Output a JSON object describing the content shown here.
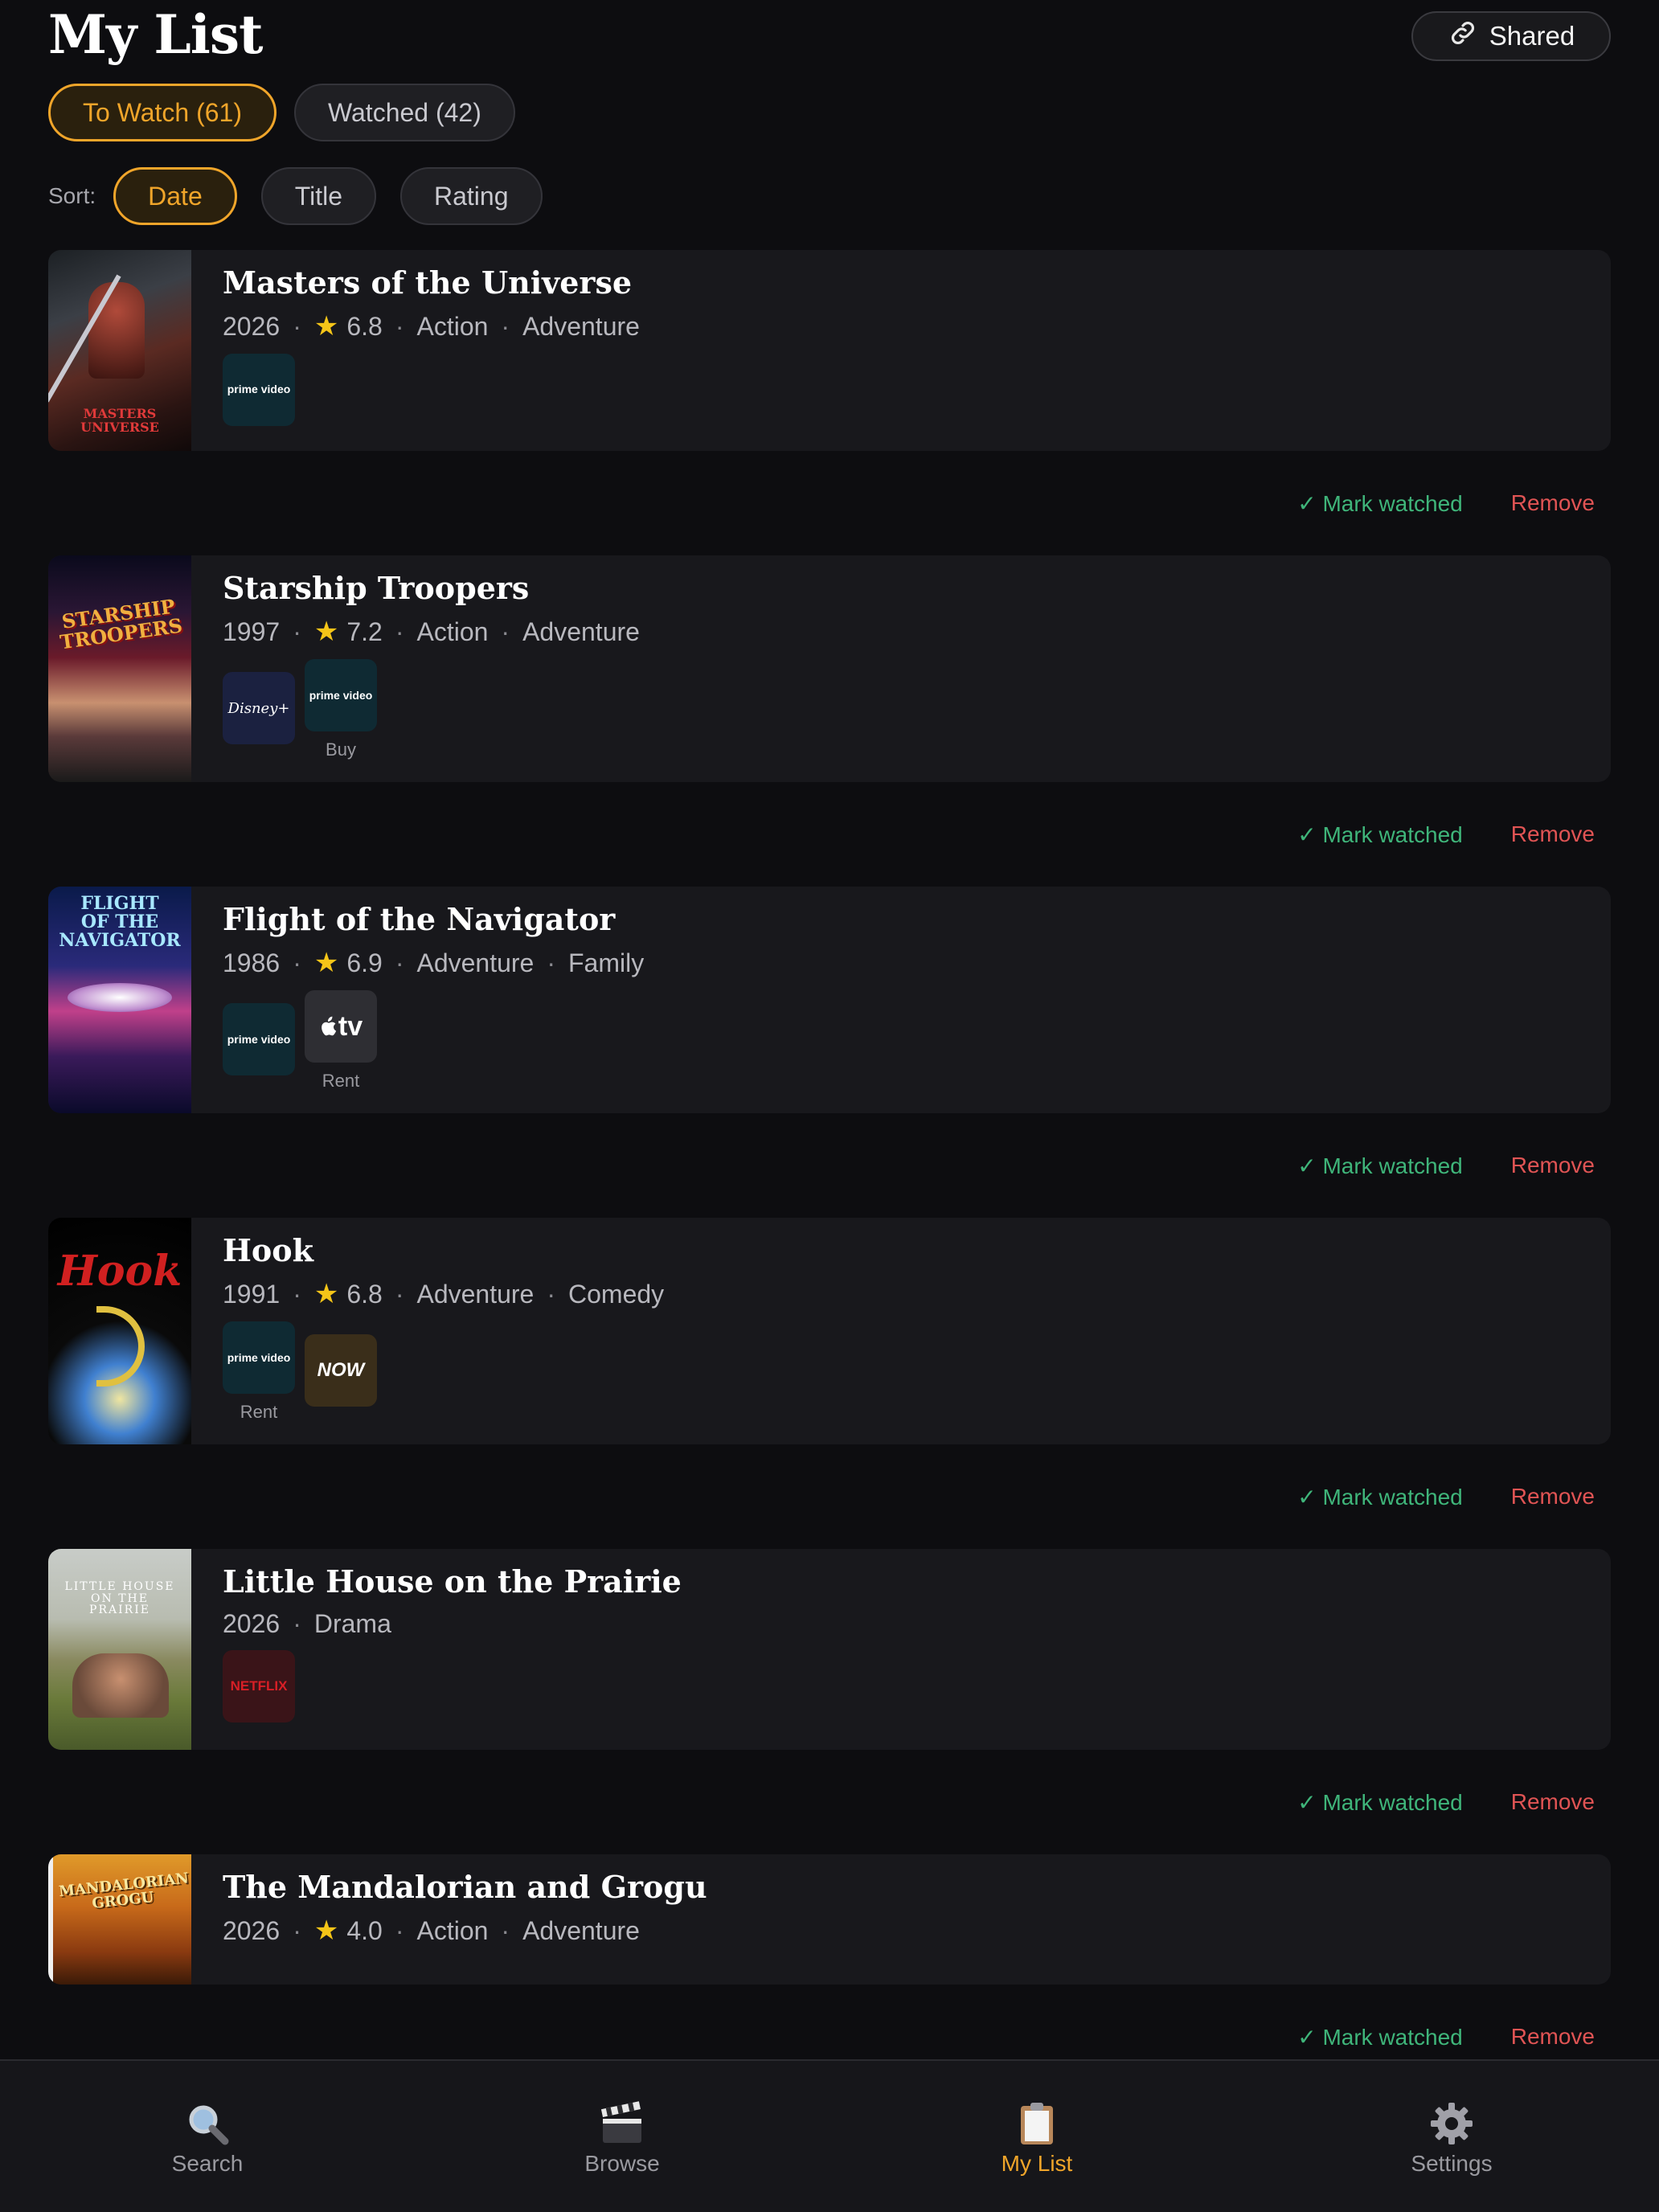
{
  "header": {
    "title": "My List",
    "shared_label": "Shared",
    "shared_icon": "link-icon"
  },
  "tabs": [
    {
      "label": "To Watch (61)",
      "active": true
    },
    {
      "label": "Watched (42)",
      "active": false
    }
  ],
  "sort": {
    "label": "Sort:",
    "options": [
      {
        "label": "Date",
        "active": true
      },
      {
        "label": "Title",
        "active": false
      },
      {
        "label": "Rating",
        "active": false
      }
    ]
  },
  "items": [
    {
      "title": "Masters of the Universe",
      "year": "2026",
      "rating": "6.8",
      "genres": [
        "Action",
        "Adventure"
      ],
      "poster_caption": "MASTERS\nUNIVERSE",
      "providers": [
        {
          "name": "prime video",
          "caption": ""
        }
      ],
      "mark_label": "✓ Mark watched",
      "remove_label": "Remove"
    },
    {
      "title": "Starship Troopers",
      "year": "1997",
      "rating": "7.2",
      "genres": [
        "Action",
        "Adventure"
      ],
      "poster_caption": "STARSHIP\nTROOPERS",
      "providers": [
        {
          "name": "Disney+",
          "caption": ""
        },
        {
          "name": "prime video",
          "caption": "Buy"
        }
      ],
      "mark_label": "✓ Mark watched",
      "remove_label": "Remove"
    },
    {
      "title": "Flight of the Navigator",
      "year": "1986",
      "rating": "6.9",
      "genres": [
        "Adventure",
        "Family"
      ],
      "poster_caption": "FLIGHT\nOF THE\nNAVIGATOR",
      "providers": [
        {
          "name": "prime video",
          "caption": ""
        },
        {
          "name": "tv",
          "caption": "Rent"
        }
      ],
      "mark_label": "✓ Mark watched",
      "remove_label": "Remove"
    },
    {
      "title": "Hook",
      "year": "1991",
      "rating": "6.8",
      "genres": [
        "Adventure",
        "Comedy"
      ],
      "poster_caption": "Hook",
      "providers": [
        {
          "name": "prime video",
          "caption": "Rent"
        },
        {
          "name": "NOW",
          "caption": ""
        }
      ],
      "mark_label": "✓ Mark watched",
      "remove_label": "Remove"
    },
    {
      "title": "Little House on the Prairie",
      "year": "2026",
      "rating": "",
      "genres": [
        "Drama"
      ],
      "poster_caption": "LITTLE HOUSE\nON THE\nPRAIRIE",
      "providers": [
        {
          "name": "NETFLIX",
          "caption": ""
        }
      ],
      "mark_label": "✓ Mark watched",
      "remove_label": "Remove"
    },
    {
      "title": "The Mandalorian and Grogu",
      "year": "2026",
      "rating": "4.0",
      "genres": [
        "Action",
        "Adventure"
      ],
      "poster_caption": "MANDALORIAN\nGROGU",
      "providers": [],
      "mark_label": "✓ Mark watched",
      "remove_label": "Remove"
    }
  ],
  "tabbar": [
    {
      "label": "Search",
      "icon": "search-icon",
      "active": false
    },
    {
      "label": "Browse",
      "icon": "clapperboard-icon",
      "active": false
    },
    {
      "label": "My List",
      "icon": "clipboard-icon",
      "active": true
    },
    {
      "label": "Settings",
      "icon": "gear-icon",
      "active": false
    }
  ],
  "colors": {
    "accent": "#f0a52a",
    "mark_watched": "#3fb57a",
    "remove": "#e05454",
    "star": "#f5c518"
  }
}
